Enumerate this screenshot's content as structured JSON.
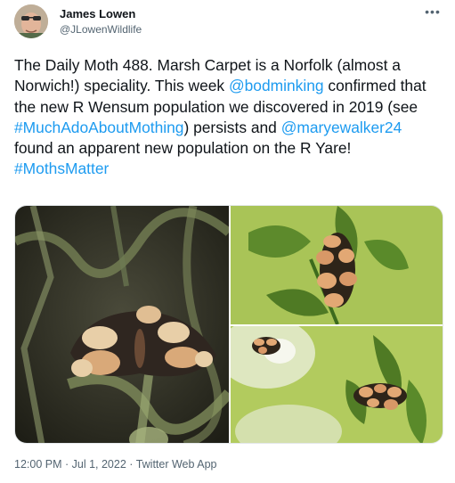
{
  "author": {
    "name": "James Lowen",
    "handle": "@JLowenWildlife"
  },
  "menu_icon": "more-dots-icon",
  "tweet": {
    "t1": "The Daily Moth 488. Marsh Carpet is a Norfolk (almost a Norwich!) speciality. This week ",
    "mention1": "@bodminking",
    "t2": " confirmed that the new R Wensum population we discovered in 2019 (see ",
    "hashtag1": "#MuchAdoAboutMothing",
    "t3": ") persists and ",
    "mention2": "@maryewalker24",
    "t4": " found an apparent new population on the R Yare! ",
    "hashtag2": "#MothsMatter"
  },
  "meta": {
    "time": "12:00 PM",
    "sep1": " · ",
    "date": "Jul 1, 2022",
    "sep2": " · ",
    "source": "Twitter Web App"
  },
  "colors": {
    "link": "#1d9bf0",
    "text": "#0f1419",
    "secondary": "#536471"
  }
}
